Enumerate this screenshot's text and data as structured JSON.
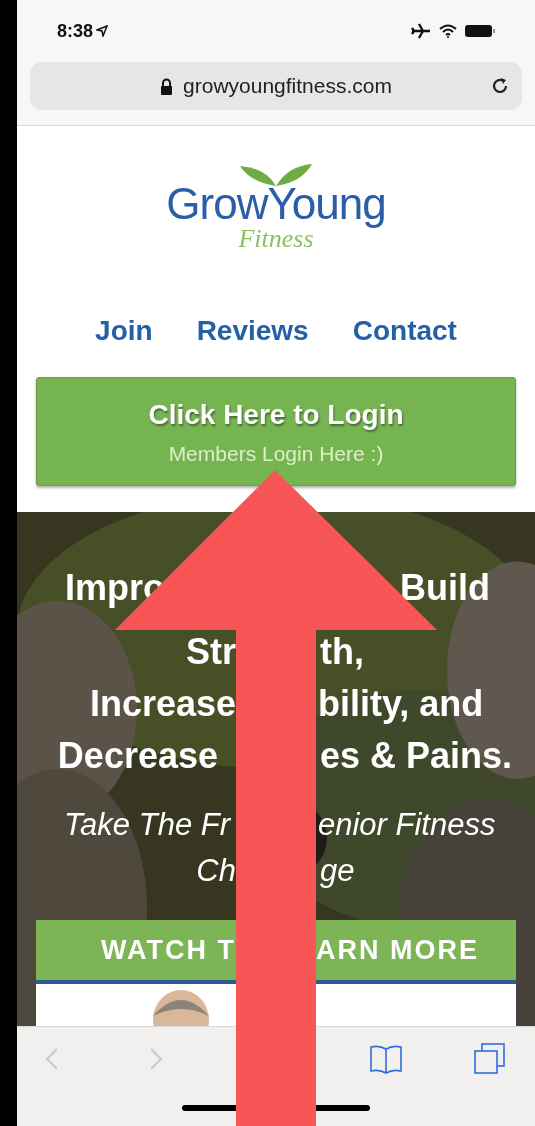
{
  "status_bar": {
    "time": "8:38"
  },
  "address_bar": {
    "url": "growyoungfitness.com"
  },
  "logo": {
    "name": "GrowYoung",
    "tagline": "Fitness"
  },
  "nav": [
    {
      "label": "Join"
    },
    {
      "label": "Reviews"
    },
    {
      "label": "Contact"
    }
  ],
  "login_button": {
    "title": "Click Here to Login",
    "subtitle": "Members Login Here :)"
  },
  "hero": {
    "lines": [
      {
        "kind": "heading",
        "left": "Impro",
        "right": "Build"
      },
      {
        "kind": "heading",
        "left": "Str",
        "right": "th,"
      },
      {
        "kind": "heading",
        "left": "Increase",
        "right": "bility, and"
      },
      {
        "kind": "heading",
        "left": "Decrease",
        "right": "es & Pains."
      },
      {
        "kind": "tagline",
        "left": "Take The Fr",
        "right": "enior Fitness"
      },
      {
        "kind": "tagline",
        "left": "Ch",
        "right": "ge"
      }
    ]
  },
  "video_card": {
    "left": "WATCH T",
    "right": "ARN MORE"
  },
  "toolbar": {
    "back_disabled": true,
    "forward_disabled": true
  }
}
